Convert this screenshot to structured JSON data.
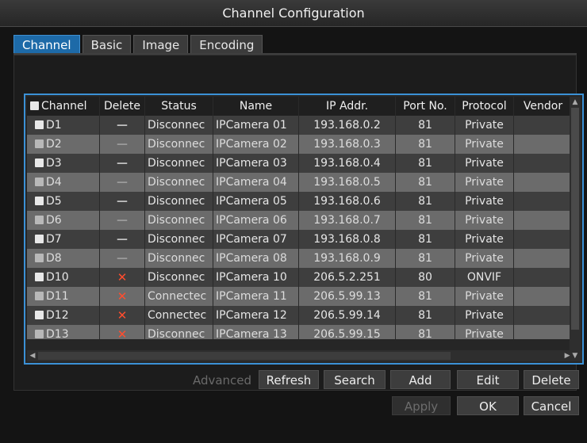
{
  "window": {
    "title": "Channel Configuration"
  },
  "tabs": [
    {
      "label": "Channel",
      "active": true
    },
    {
      "label": "Basic",
      "active": false
    },
    {
      "label": "Image",
      "active": false
    },
    {
      "label": "Encoding",
      "active": false
    }
  ],
  "table": {
    "headers": {
      "channel": "Channel",
      "delete": "Delete",
      "status": "Status",
      "name": "Name",
      "ip": "IP Addr.",
      "port": "Port No.",
      "protocol": "Protocol",
      "vendor": "Vendor"
    },
    "rows": [
      {
        "channel": "D1",
        "delete": "—",
        "status": "Disconnec",
        "name": "IPCamera 01",
        "ip": "193.168.0.2",
        "port": "81",
        "protocol": "Private"
      },
      {
        "channel": "D2",
        "delete": "—",
        "status": "Disconnec",
        "name": "IPCamera 02",
        "ip": "193.168.0.3",
        "port": "81",
        "protocol": "Private"
      },
      {
        "channel": "D3",
        "delete": "—",
        "status": "Disconnec",
        "name": "IPCamera 03",
        "ip": "193.168.0.4",
        "port": "81",
        "protocol": "Private"
      },
      {
        "channel": "D4",
        "delete": "—",
        "status": "Disconnec",
        "name": "IPCamera 04",
        "ip": "193.168.0.5",
        "port": "81",
        "protocol": "Private"
      },
      {
        "channel": "D5",
        "delete": "—",
        "status": "Disconnec",
        "name": "IPCamera 05",
        "ip": "193.168.0.6",
        "port": "81",
        "protocol": "Private"
      },
      {
        "channel": "D6",
        "delete": "—",
        "status": "Disconnec",
        "name": "IPCamera 06",
        "ip": "193.168.0.7",
        "port": "81",
        "protocol": "Private"
      },
      {
        "channel": "D7",
        "delete": "—",
        "status": "Disconnec",
        "name": "IPCamera 07",
        "ip": "193.168.0.8",
        "port": "81",
        "protocol": "Private"
      },
      {
        "channel": "D8",
        "delete": "—",
        "status": "Disconnec",
        "name": "IPCamera 08",
        "ip": "193.168.0.9",
        "port": "81",
        "protocol": "Private"
      },
      {
        "channel": "D10",
        "delete": "✕",
        "status": "Disconnec",
        "name": "IPCamera 10",
        "ip": "206.5.2.251",
        "port": "80",
        "protocol": "ONVIF"
      },
      {
        "channel": "D11",
        "delete": "✕",
        "status": "Connectec",
        "name": "IPCamera 11",
        "ip": "206.5.99.13",
        "port": "81",
        "protocol": "Private"
      },
      {
        "channel": "D12",
        "delete": "✕",
        "status": "Connectec",
        "name": "IPCamera 12",
        "ip": "206.5.99.14",
        "port": "81",
        "protocol": "Private"
      },
      {
        "channel": "D13",
        "delete": "✕",
        "status": "Disconnec",
        "name": "IPCamera 13",
        "ip": "206.5.99.15",
        "port": "81",
        "protocol": "Private"
      }
    ]
  },
  "toolbar": {
    "advanced": "Advanced",
    "refresh": "Refresh",
    "search": "Search",
    "add": "Add",
    "edit": "Edit",
    "delete": "Delete"
  },
  "footer": {
    "apply": "Apply",
    "ok": "OK",
    "cancel": "Cancel"
  },
  "icons": {
    "delete_disabled": "dash-icon",
    "delete_enabled": "red-x-icon",
    "scroll_up": "scroll-up-arrow-icon",
    "scroll_left": "scroll-left-arrow-icon",
    "scroll_right": "scroll-right-arrow-icon",
    "scroll_down": "scroll-down-arrow-icon"
  },
  "colors": {
    "accent": "#1d6aa8",
    "grid_border": "#3b91d6",
    "delete_x": "#ff4d2e"
  }
}
